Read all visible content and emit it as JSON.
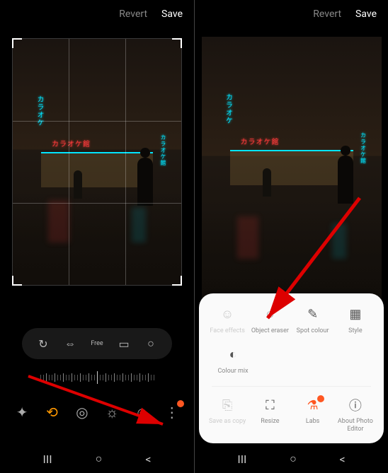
{
  "header": {
    "revert": "Revert",
    "save": "Save"
  },
  "ratio_options": [
    "rotate",
    "flip",
    "free",
    "ratio",
    "original"
  ],
  "bottom_tools": [
    "magic",
    "crop",
    "filter",
    "brightness",
    "emoji",
    "more"
  ],
  "sheet": {
    "row1": [
      {
        "key": "face-effects",
        "label": "Face effects",
        "disabled": true
      },
      {
        "key": "object-eraser",
        "label": "Object eraser"
      },
      {
        "key": "spot-colour",
        "label": "Spot colour"
      },
      {
        "key": "style",
        "label": "Style"
      }
    ],
    "row2_left": {
      "key": "colour-mix",
      "label": "Colour mix"
    },
    "row3": [
      {
        "key": "save-as-copy",
        "label": "Save as copy",
        "disabled": true
      },
      {
        "key": "resize",
        "label": "Resize"
      },
      {
        "key": "labs",
        "label": "Labs",
        "highlight": true
      },
      {
        "key": "about",
        "label": "About Photo Editor"
      }
    ]
  },
  "navbar": [
    "recents",
    "home",
    "back"
  ]
}
